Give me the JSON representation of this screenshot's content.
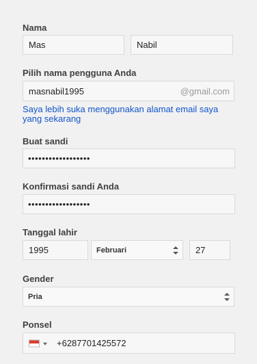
{
  "name": {
    "label": "Nama",
    "first_value": "Mas",
    "last_value": "Nabil"
  },
  "username": {
    "label": "Pilih nama pengguna Anda",
    "value": "masnabil1995",
    "suffix": "@gmail.com",
    "alt_link": "Saya lebih suka menggunakan alamat email saya yang sekarang"
  },
  "password": {
    "label": "Buat sandi",
    "value": "••••••••••••••••••"
  },
  "confirm_password": {
    "label": "Konfirmasi sandi Anda",
    "value": "••••••••••••••••••"
  },
  "birthdate": {
    "label": "Tanggal lahir",
    "year": "1995",
    "month": "Februari",
    "day": "27"
  },
  "gender": {
    "label": "Gender",
    "value": "Pria"
  },
  "phone": {
    "label": "Ponsel",
    "value": "+6287701425572",
    "flag_icon": "indonesia-flag-icon"
  },
  "colors": {
    "link": "#1155cc",
    "label": "#404040",
    "field_bg": "#f7f7f7",
    "field_border": "#d9d9d9"
  }
}
